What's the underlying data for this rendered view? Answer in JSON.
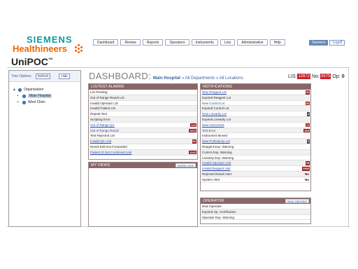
{
  "brand": {
    "line1": "SIEMENS",
    "line2": "Healthineers",
    "dots_color": "#ec6602",
    "teal": "#0f9a9e",
    "orange": "#ec6602"
  },
  "product": {
    "name": "UniPOC",
    "mark": "™"
  },
  "topnav": [
    "Dashboard",
    "Review",
    "Reports",
    "Operators",
    "Instruments",
    "Lots",
    "Administrative",
    "Help"
  ],
  "user": {
    "name": "Siemens",
    "logoff": "Logoff"
  },
  "tree": {
    "title": "Tree Options",
    "refresh": "Refresh",
    "hide": "Hide",
    "nodes": [
      {
        "label": "Organization",
        "toggle": "▲"
      },
      {
        "label": "Main Hospital",
        "toggle": "+"
      },
      {
        "label": "West Clinic",
        "toggle": "+"
      }
    ]
  },
  "dashboard": {
    "title": "DASHBOARD:",
    "crumb_main": "Main Hospital",
    "crumb_rest": "» All Departments » All Locations",
    "lis_label": "LIS:",
    "lis_value": "12672",
    "no_label": "No:",
    "no_value": "3575",
    "op_label": "Op:",
    "op_value": "0"
  },
  "lis_alarms": {
    "title": "LIS/TEST ALARMS",
    "rows": [
      {
        "label": "LIS Pending",
        "count": "",
        "link": false
      },
      {
        "label": "Out of Range Result LIS",
        "count": "",
        "link": false
      },
      {
        "label": "Invalid Operator LIS",
        "count": "",
        "link": false
      },
      {
        "label": "Invalid Patient LIS",
        "count": "",
        "link": false
      },
      {
        "label": "Repeat Test",
        "count": "",
        "link": false
      },
      {
        "label": "Scripting Error",
        "count": "",
        "link": false
      },
      {
        "label": "Out of Range QC",
        "count": "124",
        "link": true
      },
      {
        "label": "Out of Range Result",
        "count": "7874",
        "link": true
      },
      {
        "label": "Test Rejected LIS",
        "count": "",
        "link": false
      },
      {
        "label": "Invalid QC Unit",
        "count": "66",
        "link": true
      },
      {
        "label": "Result Edit Not Forwarded",
        "count": "",
        "link": false
      },
      {
        "label": "Patient ID Not Confirmed Unit",
        "count": "1141",
        "link": true
      }
    ]
  },
  "my_views": {
    "title": "MY VIEWS",
    "button": "Delete view"
  },
  "notifications": {
    "title": "NOTIFICATIONS",
    "rows": [
      {
        "label": "New Reagent Lot",
        "count": "56",
        "link": true
      },
      {
        "label": "Expired Reagent Lot",
        "count": "",
        "link": false
      },
      {
        "label": "New Control Lot",
        "count": "58",
        "link": true
      },
      {
        "label": "Expired Control Lot",
        "count": "",
        "link": false
      },
      {
        "label": "New Linearity Lot",
        "count": "4",
        "link": true
      },
      {
        "label": "Expired Linearity Lot",
        "count": "",
        "link": false
      },
      {
        "label": "New Instrument",
        "count": "72",
        "link": true
      },
      {
        "label": "Test Error",
        "count": "469",
        "link": true
      },
      {
        "label": "Instrument Moved",
        "count": "",
        "link": false
      },
      {
        "label": "New Proficiency Lot",
        "count": "3",
        "link": true
      },
      {
        "label": "Reagent Exp. Warning",
        "count": "",
        "link": false
      },
      {
        "label": "Control Exp. Warning",
        "count": "",
        "link": false
      },
      {
        "label": "Linearity Exp. Warning",
        "count": "",
        "link": false
      },
      {
        "label": "Invalid Operator Unit",
        "count": "28",
        "link": true
      },
      {
        "label": "Invalid Reagent Unit",
        "count": "2966",
        "link": true
      },
      {
        "label": "Rejected Result Alert",
        "count": "No",
        "link": false
      },
      {
        "label": "System Alert",
        "count": "No",
        "link": false
      }
    ]
  },
  "operator": {
    "title": "OPERATOR",
    "button": "New Operator",
    "rows": [
      {
        "label": "New Operator",
        "count": ""
      },
      {
        "label": "Expired Op. Certification",
        "count": ""
      },
      {
        "label": "Operator Exp. Warning",
        "count": ""
      }
    ]
  }
}
